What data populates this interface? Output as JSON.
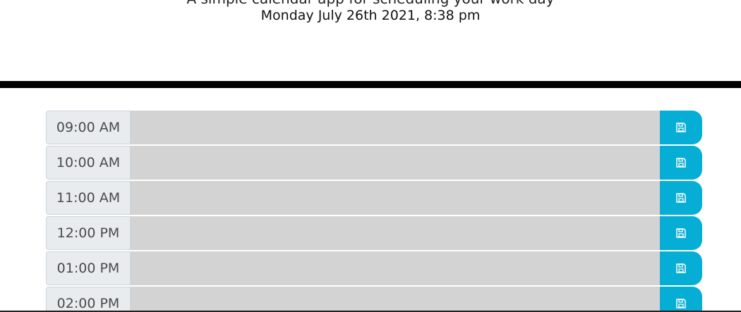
{
  "header": {
    "subtitle_cut": "A simple calendar app for scheduling your work day",
    "current_day": "Monday July 26th 2021, 8:38 pm"
  },
  "colors": {
    "divider": "#000000",
    "hour_bg": "#e9ecef",
    "description_bg": "#d3d3d3",
    "save_button_bg": "#06aed5"
  },
  "timeblocks": [
    {
      "hour": "09:00 AM",
      "description": "",
      "save_icon": "floppy-disk-icon"
    },
    {
      "hour": "10:00 AM",
      "description": "",
      "save_icon": "floppy-disk-icon"
    },
    {
      "hour": "11:00 AM",
      "description": "",
      "save_icon": "floppy-disk-icon"
    },
    {
      "hour": "12:00 PM",
      "description": "",
      "save_icon": "floppy-disk-icon"
    },
    {
      "hour": "01:00 PM",
      "description": "",
      "save_icon": "floppy-disk-icon"
    },
    {
      "hour": "02:00 PM",
      "description": "",
      "save_icon": "floppy-disk-icon"
    }
  ]
}
